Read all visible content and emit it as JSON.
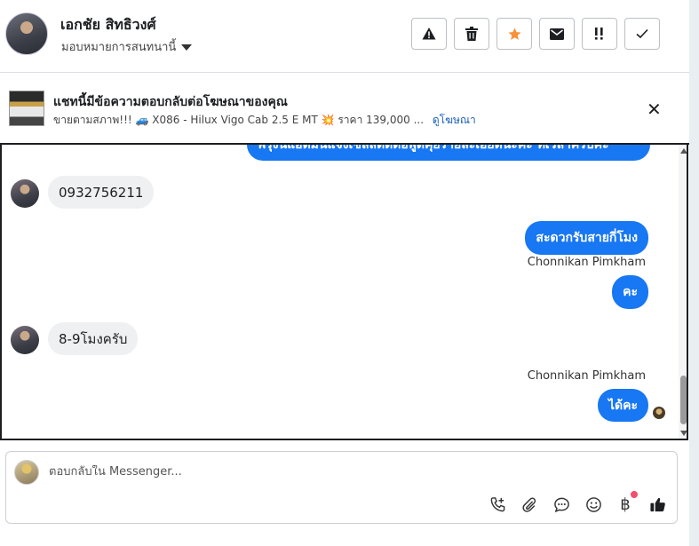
{
  "header": {
    "contact_name": "เอกชัย สิทธิวงศ์",
    "assign_label": "มอบหมายการสนทนานี้",
    "toolbar": [
      {
        "icon": "warning-icon",
        "glyph": "⚠"
      },
      {
        "icon": "trash-icon",
        "glyph": "🗑"
      },
      {
        "icon": "star-icon",
        "glyph": "★"
      },
      {
        "icon": "envelope-icon",
        "glyph": "✉"
      },
      {
        "icon": "follow-up-icon",
        "glyph": "!!"
      },
      {
        "icon": "check-icon",
        "glyph": "✓"
      }
    ]
  },
  "ad": {
    "title": "แชทนี้มีข้อความตอบกลับต่อโฆษณาของคุณ",
    "description": "ขายตามสภาพ!!! 🚙 X086 - Hilux Vigo Cab 2.5 E MT 💥 ราคา 139,000 ...",
    "link": "ดูโฆษณา",
    "close_glyph": "✕"
  },
  "messages": {
    "top_partial": "พรุ่งนี้แอดมินแจ้งเซลล์ติดต่อพูดคุยรายละเอียดนะคะ ที่เวลาครับคะ",
    "m1": "0932756211",
    "m2": "สะดวกรับสายกี่โมง",
    "m2_sender": "Chonnikan Pimkham",
    "m3": "คะ",
    "m4": "8-9โมงครับ",
    "m5_sender": "Chonnikan Pimkham",
    "m5": "ได้คะ"
  },
  "composer": {
    "placeholder": "ตอบกลับใน Messenger...",
    "baht_glyph": "฿",
    "icons": [
      "add-call-icon",
      "attachment-icon",
      "saved-reply-icon",
      "emoji-icon",
      "payment-icon",
      "like-icon"
    ]
  },
  "colors": {
    "brand_blue": "#1877f2",
    "star_orange": "#f7923a",
    "notification_dot": "#f0506e"
  }
}
